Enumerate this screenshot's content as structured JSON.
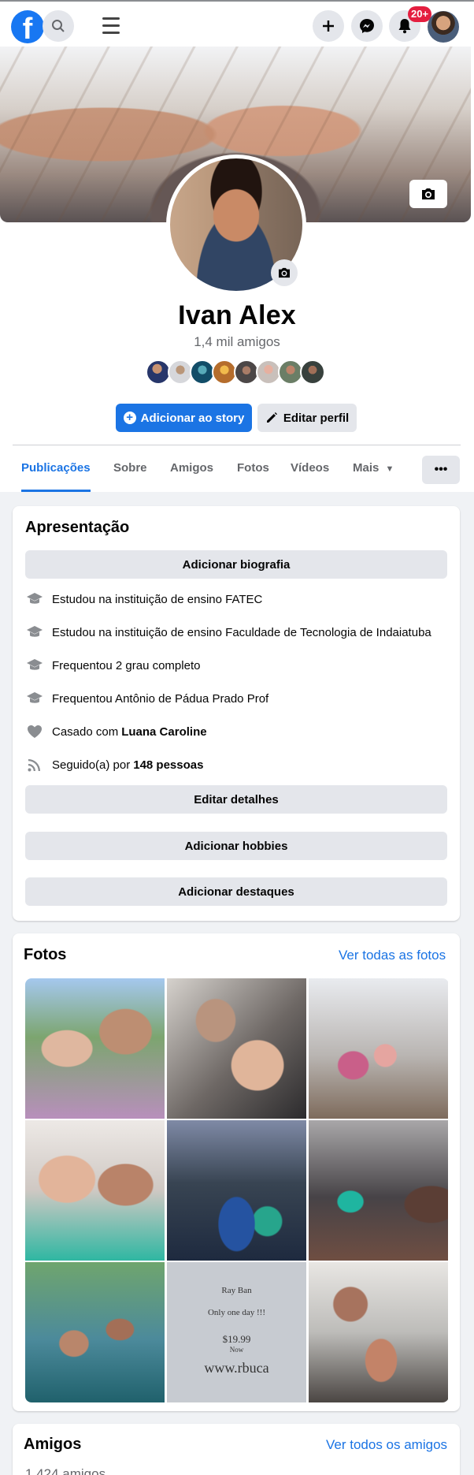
{
  "topbar": {
    "logo": "f",
    "notification_count": "20+",
    "icons": [
      "facebook-logo-icon",
      "search-icon",
      "menu-icon",
      "plus-icon",
      "messenger-icon",
      "bell-icon",
      "avatar"
    ]
  },
  "profile": {
    "name": "Ivan Alex",
    "friends_summary": "1,4 mil amigos",
    "add_story_label": "Adicionar ao story",
    "edit_profile_label": "Editar perfil"
  },
  "tabs": [
    {
      "label": "Publicações"
    },
    {
      "label": "Sobre"
    },
    {
      "label": "Amigos"
    },
    {
      "label": "Fotos"
    },
    {
      "label": "Vídeos"
    },
    {
      "label": "Mais"
    }
  ],
  "more_label": "•••",
  "intro": {
    "title": "Apresentação",
    "add_bio": "Adicionar biografia",
    "details": [
      {
        "prefix": "Estudou na instituição de ensino FATEC",
        "bold": "",
        "icon": "graduation-cap-icon"
      },
      {
        "prefix": "Estudou na instituição de ensino Faculdade de Tecnologia de Indaiatuba",
        "bold": "",
        "icon": "graduation-cap-icon"
      },
      {
        "prefix": "Frequentou 2 grau completo",
        "bold": "",
        "icon": "graduation-cap-icon"
      },
      {
        "prefix": "Frequentou Antônio de Pádua Prado Prof",
        "bold": "",
        "icon": "graduation-cap-icon"
      },
      {
        "prefix": "Casado com",
        "bold": "Luana Caroline",
        "icon": "heart-icon"
      },
      {
        "prefix": "Seguido(a) por",
        "bold": "148 pessoas",
        "icon": "rss-icon"
      }
    ],
    "edit_details": "Editar detalhes",
    "add_hobbies": "Adicionar hobbies",
    "add_highlights": "Adicionar destaques"
  },
  "photos": {
    "title": "Fotos",
    "see_all": "Ver todas as fotos",
    "thumbnail_text": [
      "Ray Ban",
      "Only one day !!!",
      "$19.99",
      "Now",
      "www.rbuca"
    ]
  },
  "friends": {
    "title": "Amigos",
    "see_all": "Ver todos os amigos",
    "count": "1.424 amigos"
  },
  "colors": {
    "brand": "#1877f2",
    "button_blue": "#1b74e4",
    "badge_red": "#e41e3f",
    "background": "#f0f2f5"
  }
}
